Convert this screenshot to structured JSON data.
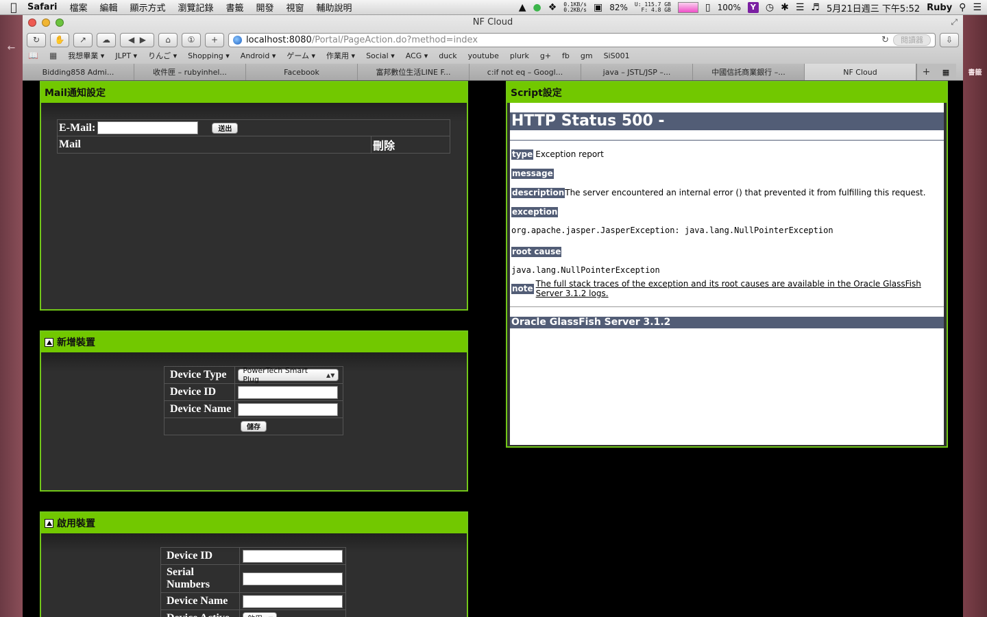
{
  "menubar": {
    "app": "Safari",
    "items": [
      "檔案",
      "編輯",
      "顯示方式",
      "瀏覽記錄",
      "書籤",
      "開發",
      "視窗",
      "輔助說明"
    ],
    "net_up": "0.1KB/s",
    "net_down": "0.2KB/s",
    "cpu": "82%",
    "disk_u": "U: 115.7 GB",
    "disk_f": "F: 4.8 GB",
    "battery": "100%",
    "datetime": "5月21日週三 下午5:52",
    "user": "Ruby"
  },
  "window": {
    "title": "NF Cloud",
    "url_host": "localhost:8080",
    "url_path": "/Portal/PageAction.do?method=index",
    "reader_label": "閱讀器"
  },
  "bookmarks": [
    "我想畢業 ▾",
    "JLPT ▾",
    "りんご ▾",
    "Shopping ▾",
    "Android ▾",
    "ゲーム ▾",
    "作業用 ▾",
    "Social ▾",
    "ACG ▾",
    "duck",
    "youtube",
    "plurk",
    "g+",
    "fb",
    "gm",
    "SiS001"
  ],
  "tabs": [
    {
      "label": "Bidding858 Admi..."
    },
    {
      "label": "收件匣 – rubyinhel..."
    },
    {
      "label": "Facebook"
    },
    {
      "label": "富邦數位生活LINE F..."
    },
    {
      "label": "c:if not eq – Googl..."
    },
    {
      "label": "java – JSTL/JSP –..."
    },
    {
      "label": "中國信託商業銀行 –..."
    },
    {
      "label": "NF Cloud"
    }
  ],
  "desktop": {
    "right_label": "書籤"
  },
  "mail_panel": {
    "title": "Mail通知設定",
    "email_label": "E-Mail:",
    "email_value": "",
    "submit_label": "送出",
    "col_mail": "Mail",
    "col_delete": "刪除"
  },
  "add_device_panel": {
    "title": "新增裝置",
    "device_type_label": "Device Type",
    "device_type_value": "PowerTech Smart Plug",
    "device_id_label": "Device ID",
    "device_id_value": "",
    "device_name_label": "Device Name",
    "device_name_value": "",
    "save_label": "儲存"
  },
  "enable_device_panel": {
    "title": "啟用裝置",
    "device_id_label": "Device ID",
    "serial_label": "Serial Numbers",
    "device_name_label": "Device Name",
    "device_active_label": "Device Active",
    "device_active_value": "啟用"
  },
  "script_panel": {
    "title": "Script設定",
    "error": {
      "heading": "HTTP Status 500 -",
      "type_tag": "type",
      "type_text": "Exception report",
      "message_tag": "message",
      "description_tag": "description",
      "description_text": "The server encountered an internal error () that prevented it from fulfilling this request.",
      "exception_tag": "exception",
      "exception_text": "org.apache.jasper.JasperException: java.lang.NullPointerException",
      "root_cause_tag": "root cause",
      "root_cause_text": "java.lang.NullPointerException",
      "note_tag": "note",
      "note_text": "The full stack traces of the exception and its root causes are available in the Oracle GlassFish Server 3.1.2 logs.",
      "server": "Oracle GlassFish Server 3.1.2"
    }
  },
  "colors": {
    "panel_header": "#72c800",
    "panel_body": "#2f2f2f",
    "error_tag": "#525d76"
  }
}
